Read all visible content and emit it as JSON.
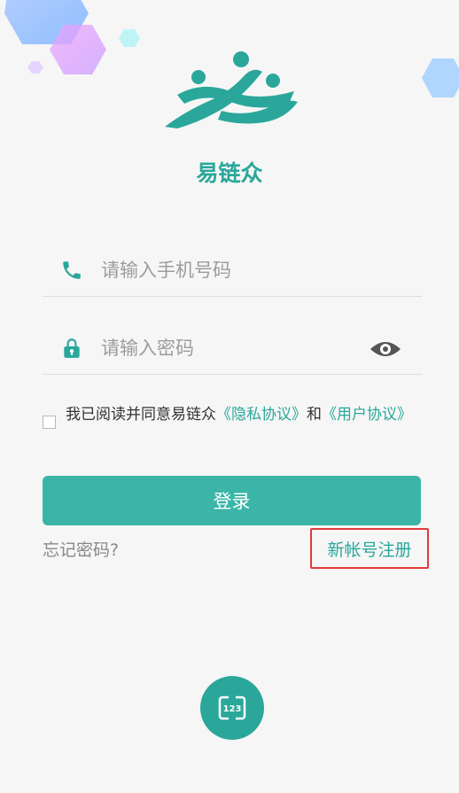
{
  "app": {
    "name": "易链众"
  },
  "login": {
    "phone_placeholder": "请输入手机号码",
    "password_placeholder": "请输入密码",
    "agreement_prefix": "我已阅读并同意易链众",
    "privacy_link": "《隐私协议》",
    "agreement_and": "和",
    "user_link": "《用户协议》",
    "submit_label": "登录",
    "forgot_label": "忘记密码?",
    "register_label": "新帐号注册"
  },
  "icons": {
    "phone": "phone-icon",
    "lock": "lock-icon",
    "eye": "eye-icon",
    "keyboard": "numeric-keyboard-icon"
  },
  "colors": {
    "brand": "#2aa79a",
    "button": "#3bb5a8",
    "highlight_box": "#e23a3a"
  }
}
